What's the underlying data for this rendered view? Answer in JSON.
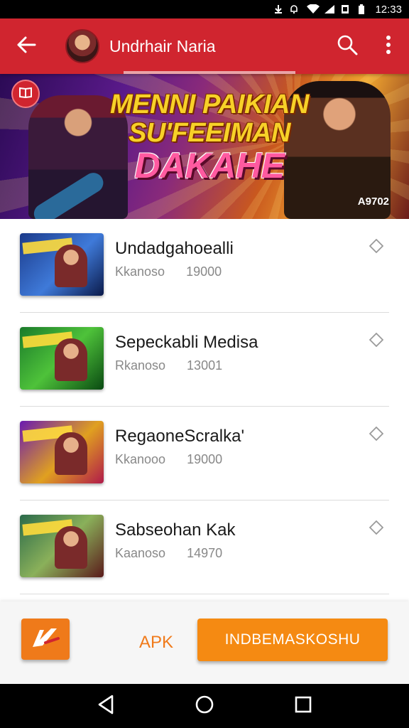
{
  "status_bar": {
    "time": "12:33",
    "icons": [
      "download-icon",
      "notification-icon",
      "wifi-icon",
      "signal-icon",
      "sim-icon",
      "battery-icon"
    ]
  },
  "app_bar": {
    "title": "Undrhair Naria",
    "back_icon": "arrow-left-icon",
    "search_icon": "search-icon",
    "menu_icon": "more-vertical-icon",
    "color": "#d0252f"
  },
  "banner": {
    "headline_line1": "MENNI PAIKIAN",
    "headline_line2": "SU'FEEIMAN",
    "headline_line3": "DAKAHE",
    "code": "A9702",
    "badge_icon": "book-icon"
  },
  "list": {
    "items": [
      {
        "name": "Undadgahoealli",
        "publisher": "Kkanoso",
        "count": "19000"
      },
      {
        "name": "Sepeckabli Medisa",
        "publisher": "Rkanoso",
        "count": "13001"
      },
      {
        "name": "RegaoneScralka'",
        "publisher": "Kkanooo",
        "count": "19000"
      },
      {
        "name": "Sabseohan Kak",
        "publisher": "Kaanoso",
        "count": "14970"
      }
    ],
    "favorite_icon": "diamond-outline-icon"
  },
  "action_bar": {
    "apk_label": "APK",
    "primary_label": "INDBEMASKOSHU",
    "accent": "#f58a12"
  },
  "nav_bar": {
    "icons": [
      "back-triangle-icon",
      "home-circle-icon",
      "recents-square-icon"
    ]
  }
}
